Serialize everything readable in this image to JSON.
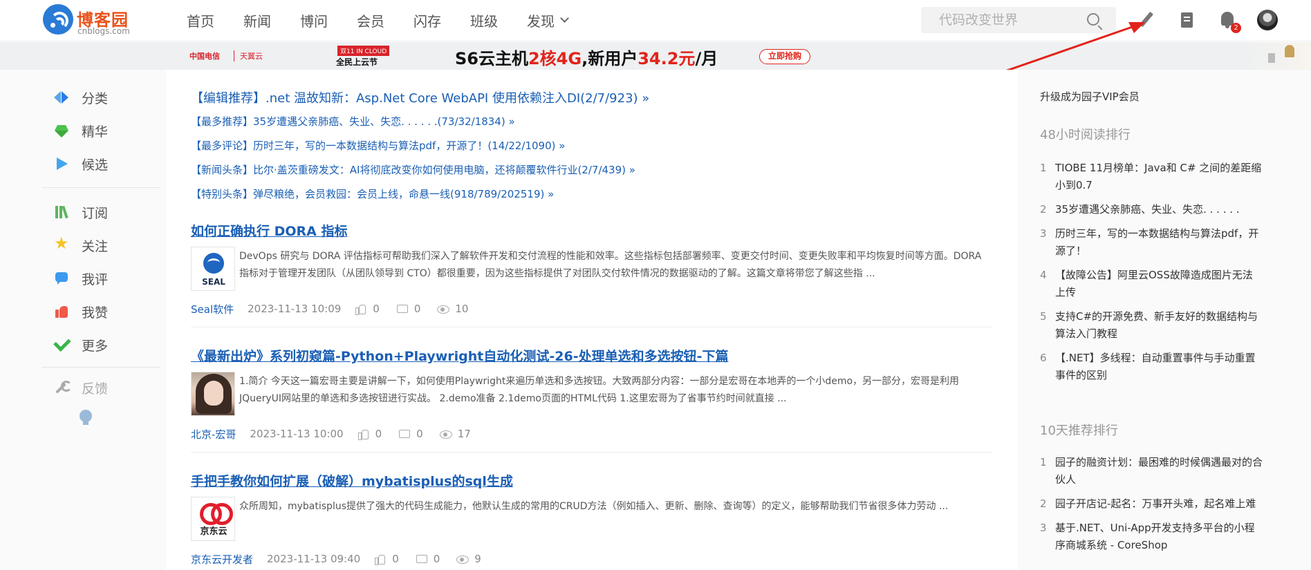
{
  "header": {
    "logo_title": "博客园",
    "logo_sub": "cnblogs.com",
    "nav": [
      "首页",
      "新闻",
      "博问",
      "会员",
      "闪存",
      "班级",
      "发现"
    ],
    "search_placeholder": "代码改变世界",
    "notification_count": "2"
  },
  "banner": {
    "brand_ct": "中国电信",
    "brand_tyy": "天翼云",
    "tag_top": "双11 IN CLOUD",
    "tag_bottom": "全民上云节",
    "headline_prefix": "S6云主机",
    "headline_highlight1": "2核4G",
    "headline_mid": ",新用户",
    "headline_highlight2": "34.2元",
    "headline_suffix": "/月",
    "button": "立即抢购"
  },
  "left_sidebar": {
    "group1": [
      "分类",
      "精华",
      "候选"
    ],
    "group2": [
      "订阅",
      "关注",
      "我评",
      "我赞",
      "更多"
    ],
    "feedback": "反馈"
  },
  "headlines": [
    "【编辑推荐】.net 温故知新：Asp.Net Core WebAPI 使用依赖注入DI(2/7/923) »",
    "【最多推荐】35岁遭遇父亲肺癌、失业、失恋. . . . . .(73/32/1834) »",
    "【最多评论】历时三年，写的一本数据结构与算法pdf，开源了！(14/22/1090) »",
    "【新闻头条】比尔·盖茨重磅发文：AI将彻底改变你如何使用电脑，还将颠覆软件行业(2/7/439) »",
    "【特别头条】弹尽粮绝，会员救园：会员上线，命悬一线(918/789/202519) »"
  ],
  "posts": [
    {
      "title": "如何正确执行 DORA 指标",
      "summary": "DevOps 研究与 DORA 评估指标可帮助我们深入了解软件开发和交付流程的性能和效率。这些指标包括部署频率、变更交付时间、变更失败率和平均恢复时间等方面。DORA 指标对于管理开发团队（从团队领导到 CTO）都很重要，因为这些指标提供了对团队交付软件情况的数据驱动的了解。这篇文章将带您了解这些指 ...",
      "thumb_label": "SEAL",
      "author": "Seal软件",
      "date": "2023-11-13 10:09",
      "likes": "0",
      "comments": "0",
      "views": "10"
    },
    {
      "title": "《最新出炉》系列初窥篇-Python+Playwright自动化测试-26-处理单选和多选按钮-下篇",
      "summary": "1.简介 今天这一篇宏哥主要是讲解一下，如何使用Playwright来遍历单选和多选按钮。大致两部分内容：一部分是宏哥在本地弄的一个小demo，另一部分，宏哥是利用JQueryUI网站里的单选和多选按钮进行实战。 2.demo准备 2.1demo页面的HTML代码 1.这里宏哥为了省事节约时间就直接 ...",
      "thumb_label": "",
      "author": "北京-宏哥",
      "date": "2023-11-13 10:00",
      "likes": "0",
      "comments": "0",
      "views": "17"
    },
    {
      "title": "手把手教你如何扩展（破解）mybatisplus的sql生成",
      "summary": "众所周知，mybatisplus提供了强大的代码生成能力，他默认生成的常用的CRUD方法（例如插入、更新、删除、查询等）的定义，能够帮助我们节省很多体力劳动 ...",
      "thumb_label": "京东云",
      "author": "京东云开发者",
      "date": "2023-11-13 09:40",
      "likes": "0",
      "comments": "0",
      "views": "9"
    }
  ],
  "right_sidebar": {
    "vip": "升级成为园子VIP会员",
    "rank48_title": "48小时阅读排行",
    "rank48": [
      {
        "no": "1",
        "text": "TIOBE 11月榜单：Java和 C# 之间的差距缩小到0.7"
      },
      {
        "no": "2",
        "text": "35岁遭遇父亲肺癌、失业、失恋. . . . . ."
      },
      {
        "no": "3",
        "text": "历时三年，写的一本数据结构与算法pdf，开源了！"
      },
      {
        "no": "4",
        "text": "【故障公告】阿里云OSS故障造成图片无法上传"
      },
      {
        "no": "5",
        "text": "支持C#的开源免费、新手友好的数据结构与算法入门教程"
      },
      {
        "no": "6",
        "text": "【.NET】多线程：自动重置事件与手动重置事件的区别"
      }
    ],
    "rank10_title": "10天推荐排行",
    "rank10": [
      {
        "no": "1",
        "text": "园子的融资计划：最困难的时候偶遇最对的合伙人"
      },
      {
        "no": "2",
        "text": "园子开店记-起名：万事开头难，起名难上难"
      },
      {
        "no": "3",
        "text": "基于.NET、Uni-App开发支持多平台的小程序商城系统 - CoreShop"
      }
    ]
  },
  "colors": {
    "link": "#1a5fb4",
    "brand": "#e9541d",
    "accent_red": "#e2231a"
  }
}
